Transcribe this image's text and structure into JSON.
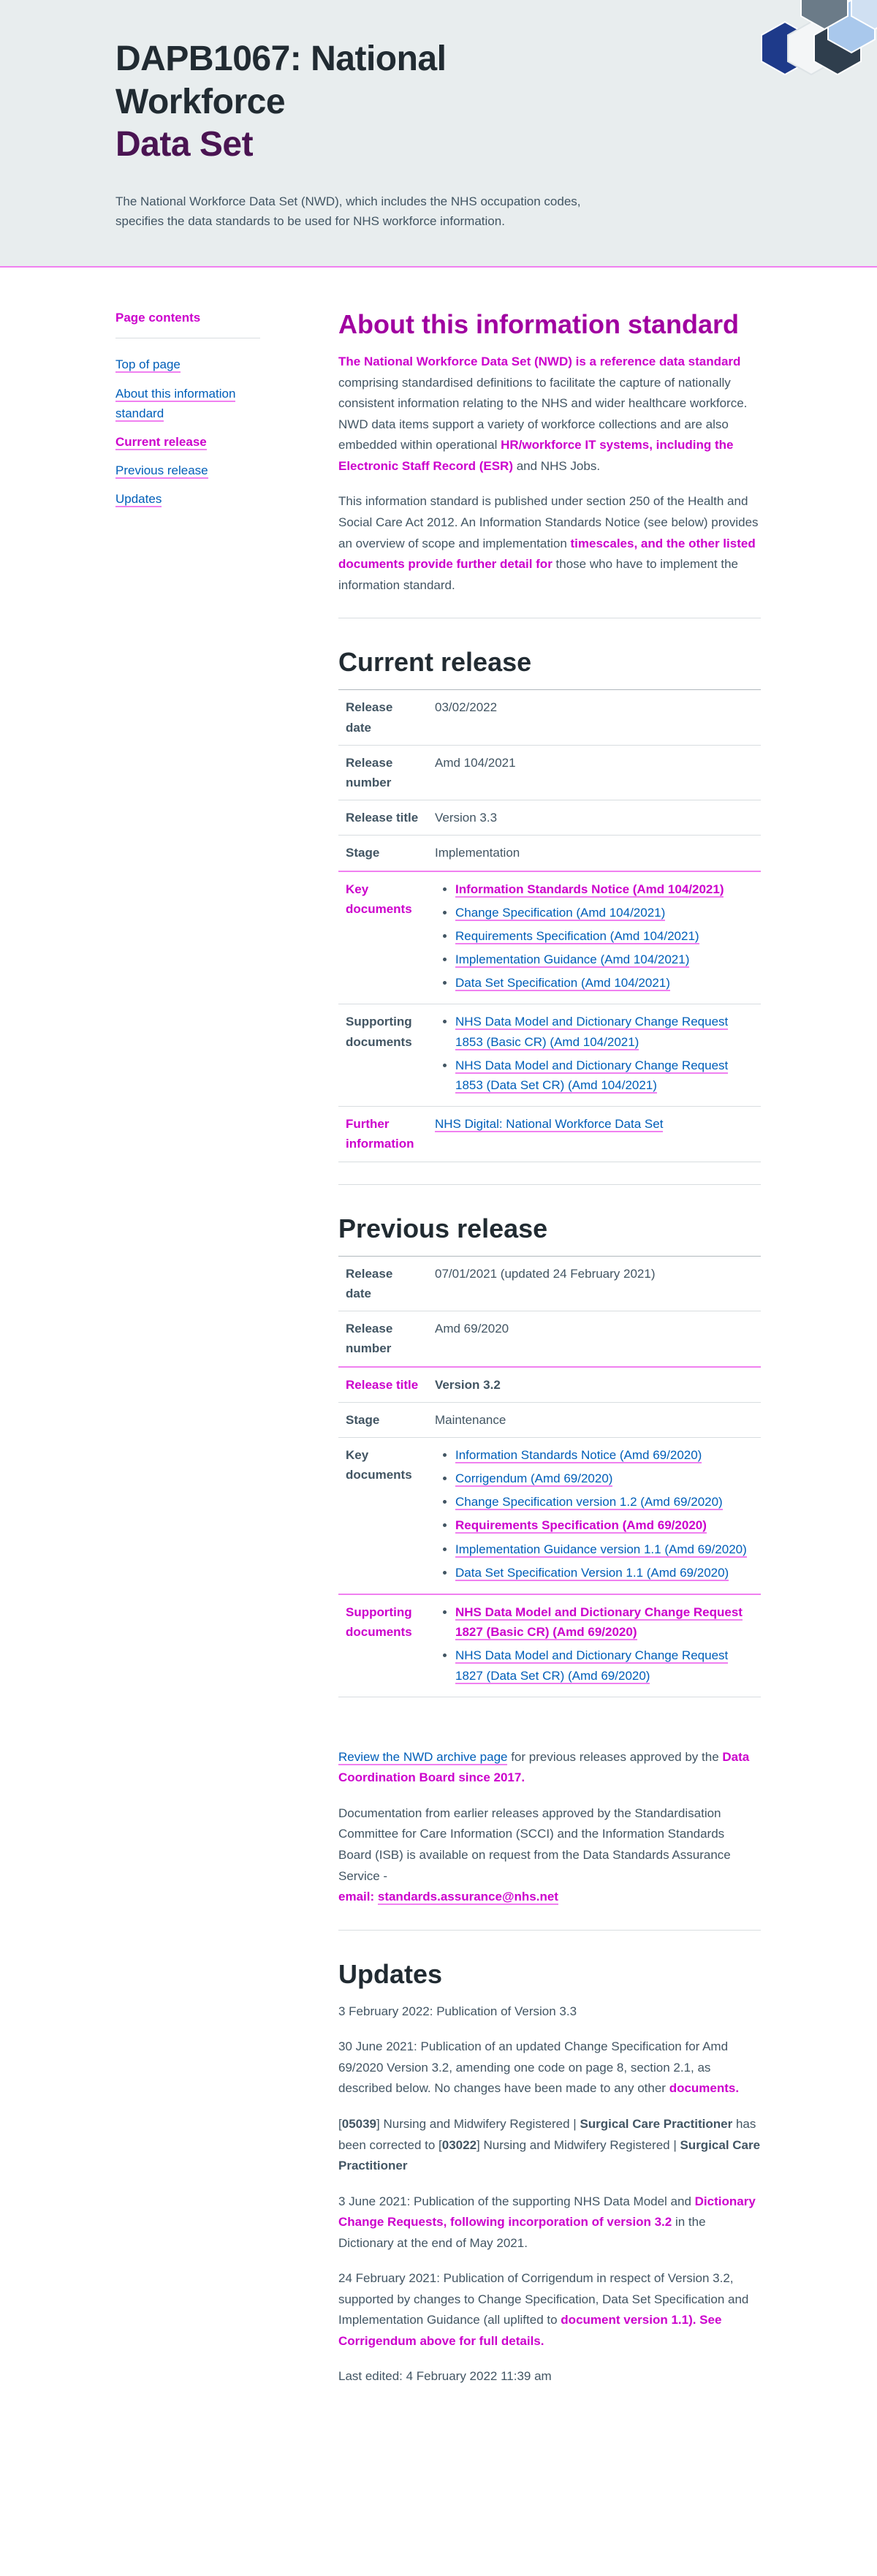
{
  "header": {
    "title_line1": "DAPB1067: National Workforce",
    "title_line2": "Data Set",
    "intro": "The National Workforce Data Set (NWD), which includes the NHS occupation codes, specifies the data standards to be used for NHS workforce information."
  },
  "toc": {
    "title": "Page contents",
    "items": [
      {
        "label": "Top of page"
      },
      {
        "label": "About this information standard"
      },
      {
        "label": "Current release"
      },
      {
        "label": "Previous release"
      },
      {
        "label": "Updates"
      }
    ]
  },
  "about": {
    "heading": "About this information standard",
    "p1_highlight": "The National Workforce Data Set (NWD) is a reference data standard",
    "p1_a": " comprising standardised definitions to facilitate the capture of nationally consistent information relating to the NHS and wider healthcare workforce. NWD data items support a variety of workforce collections and are also embedded within operational ",
    "p1_highlight2": "HR/workforce IT systems, including the Electronic Staff Record (ESR)",
    "p1_b": " and NHS Jobs.",
    "p2_a": "This information standard is published under section 250 of the Health and Social Care Act 2012. An Information Standards Notice (see below) provides an overview of scope and implementation ",
    "p2_highlight": "timescales, and the other listed documents provide further detail for",
    "p2_b": " those who have to implement the information standard."
  },
  "current": {
    "heading": "Current release",
    "labels": {
      "release_date": "Release date",
      "release_number": "Release number",
      "release_title": "Release title",
      "stage": "Stage",
      "key_documents": "Key documents",
      "supporting_documents": "Supporting documents",
      "further_information": "Further information"
    },
    "release_date": "03/02/2022",
    "release_number": "Amd 104/2021",
    "release_title": "Version 3.3",
    "stage": "Implementation",
    "key_documents": [
      "Information Standards Notice (Amd 104/2021)",
      "Change Specification (Amd 104/2021)",
      "Requirements Specification (Amd 104/2021)",
      "Implementation Guidance (Amd 104/2021)",
      "Data Set Specification (Amd 104/2021)"
    ],
    "supporting_documents": [
      "NHS Data Model and Dictionary Change Request 1853 (Basic CR) (Amd 104/2021)",
      "NHS Data Model and Dictionary Change Request 1853 (Data Set CR) (Amd 104/2021)"
    ],
    "further_information": "NHS Digital: National Workforce Data Set"
  },
  "previous": {
    "heading": "Previous release",
    "labels": {
      "release_date": "Release date",
      "release_number": "Release number",
      "release_title": "Release title",
      "stage": "Stage",
      "key_documents": "Key documents",
      "supporting_documents": "Supporting documents"
    },
    "release_date": "07/01/2021 (updated 24 February 2021)",
    "release_number": "Amd 69/2020",
    "release_title": "Version 3.2",
    "stage": "Maintenance",
    "key_documents": [
      "Information Standards Notice (Amd 69/2020)",
      "Corrigendum (Amd 69/2020)",
      "Change Specification version 1.2 (Amd 69/2020)",
      "Requirements Specification (Amd 69/2020)",
      "Implementation Guidance version 1.1 (Amd 69/2020)",
      "Data Set Specification Version 1.1 (Amd 69/2020)"
    ],
    "supporting_documents": [
      "NHS Data Model and Dictionary Change Request 1827 (Basic CR) (Amd 69/2020)",
      "NHS Data Model and Dictionary Change Request 1827 (Data Set CR) (Amd 69/2020)"
    ]
  },
  "archive": {
    "link": "Review the NWD archive page",
    "text_a": " for previous releases approved by the ",
    "text_highlight": "Data Coordination Board since 2017.",
    "p2": "Documentation from earlier releases approved by the Standardisation Committee for Care Information (SCCI) and the Information Standards Board (ISB) is available on request from the Data Standards Assurance Service -",
    "email_label": "email: ",
    "email": "standards.assurance@nhs.net"
  },
  "updates": {
    "heading": "Updates",
    "u1": "3 February 2022: Publication of Version 3.3",
    "u2_a": "30 June 2021: Publication of an updated Change Specification for Amd 69/2020 Version 3.2, amending one code on page 8, section 2.1, as described below. No changes have been made to any other ",
    "u2_highlight": "documents.",
    "u3_b1": "[",
    "u3_code1": "05039",
    "u3_b2": "] Nursing and Midwifery Registered | ",
    "u3_bold1": "Surgical Care Practitioner",
    "u3_b3": " has been corrected to [",
    "u3_code2": "03022",
    "u3_b4": "] Nursing and Midwifery Registered | ",
    "u3_bold2": "Surgical Care Practitioner",
    "u4_a": "3 June 2021: Publication of the supporting NHS Data Model and ",
    "u4_highlight": "Dictionary Change Requests, following incorporation of version 3.2",
    "u4_b": " in the Dictionary at the end of May 2021.",
    "u5_a": "24 February 2021: Publication of Corrigendum in respect of Version 3.2, supported by changes to Change Specification, Data Set Specification and Implementation Guidance (all uplifted to ",
    "u5_highlight": "document version 1.1). See Corrigendum above for full details.",
    "last_edited": "Last edited: 4 February 2022 11:39 am"
  }
}
